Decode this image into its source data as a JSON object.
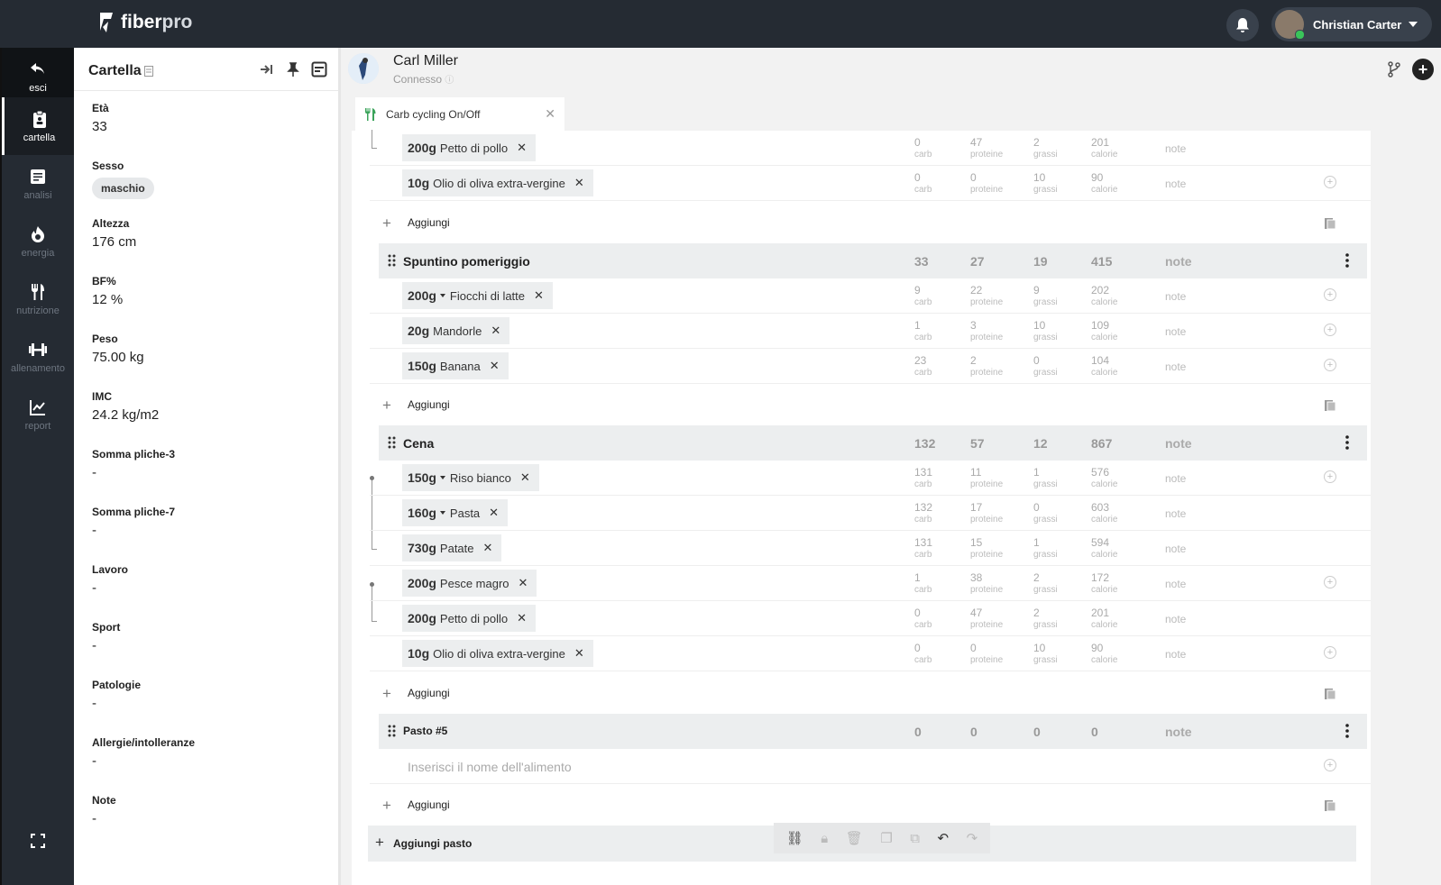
{
  "brand": {
    "name_a": "fiber",
    "name_b": "pro"
  },
  "header": {
    "user_name": "Christian Carter"
  },
  "nav": [
    {
      "label": "esci",
      "icon": "back-arrow-icon"
    },
    {
      "label": "cartella",
      "icon": "clipboard-icon"
    },
    {
      "label": "analisi",
      "icon": "document-icon"
    },
    {
      "label": "energia",
      "icon": "flame-icon"
    },
    {
      "label": "nutrizione",
      "icon": "cutlery-icon"
    },
    {
      "label": "allenamento",
      "icon": "dumbbell-icon"
    },
    {
      "label": "report",
      "icon": "chart-icon"
    }
  ],
  "panel": {
    "title": "Cartella",
    "fields": [
      {
        "label": "Età",
        "value": "33"
      },
      {
        "label": "Sesso",
        "value": "maschio"
      },
      {
        "label": "Altezza",
        "value": "176 cm"
      },
      {
        "label": "BF%",
        "value": "12 %"
      },
      {
        "label": "Peso",
        "value": "75.00 kg"
      },
      {
        "label": "IMC",
        "value": "24.2 kg/m2"
      },
      {
        "label": "Somma pliche-3",
        "value": "-"
      },
      {
        "label": "Somma pliche-7",
        "value": "-"
      },
      {
        "label": "Lavoro",
        "value": "-"
      },
      {
        "label": "Sport",
        "value": "-"
      },
      {
        "label": "Patologie",
        "value": "-"
      },
      {
        "label": "Allergie/intolleranze",
        "value": "-"
      },
      {
        "label": "Note",
        "value": "-"
      }
    ]
  },
  "patient": {
    "name": "Carl Miller",
    "status": "Connesso"
  },
  "tab": {
    "label": "Carb cycling On/Off"
  },
  "units": {
    "carb": "carb",
    "prot": "proteine",
    "fat": "grassi",
    "kcal": "calorie"
  },
  "note_label": "note",
  "add_label": "Aggiungi",
  "add_meal_label": "Aggiungi pasto",
  "food_placeholder": "Inserisci il nome dell'alimento",
  "rows_top": [
    {
      "qty": "200g",
      "food": "Petto di pollo",
      "carb": "0",
      "prot": "47",
      "fat": "2",
      "kcal": "201"
    },
    {
      "qty": "10g",
      "food": "Olio di oliva extra-vergine",
      "carb": "0",
      "prot": "0",
      "fat": "10",
      "kcal": "90"
    }
  ],
  "meals": [
    {
      "name": "Spuntino pomeriggio",
      "carb": "33",
      "prot": "27",
      "fat": "19",
      "kcal": "415",
      "items": [
        {
          "qty": "200g",
          "food": "Fiocchi di latte",
          "dd": true,
          "carb": "9",
          "prot": "22",
          "fat": "9",
          "kcal": "202"
        },
        {
          "qty": "20g",
          "food": "Mandorle",
          "dd": false,
          "carb": "1",
          "prot": "3",
          "fat": "10",
          "kcal": "109"
        },
        {
          "qty": "150g",
          "food": "Banana",
          "dd": false,
          "carb": "23",
          "prot": "2",
          "fat": "0",
          "kcal": "104"
        }
      ]
    },
    {
      "name": "Cena",
      "carb": "132",
      "prot": "57",
      "fat": "12",
      "kcal": "867",
      "items": [
        {
          "qty": "150g",
          "food": "Riso bianco",
          "dd": true,
          "carb": "131",
          "prot": "11",
          "fat": "1",
          "kcal": "576"
        },
        {
          "qty": "160g",
          "food": "Pasta",
          "dd": true,
          "carb": "132",
          "prot": "17",
          "fat": "0",
          "kcal": "603"
        },
        {
          "qty": "730g",
          "food": "Patate",
          "dd": false,
          "carb": "131",
          "prot": "15",
          "fat": "1",
          "kcal": "594"
        },
        {
          "qty": "200g",
          "food": "Pesce magro",
          "dd": false,
          "carb": "1",
          "prot": "38",
          "fat": "2",
          "kcal": "172"
        },
        {
          "qty": "200g",
          "food": "Petto di pollo",
          "dd": false,
          "carb": "0",
          "prot": "47",
          "fat": "2",
          "kcal": "201"
        },
        {
          "qty": "10g",
          "food": "Olio di oliva extra-vergine",
          "dd": false,
          "carb": "0",
          "prot": "0",
          "fat": "10",
          "kcal": "90"
        }
      ]
    },
    {
      "name": "Pasto #5",
      "carb": "0",
      "prot": "0",
      "fat": "0",
      "kcal": "0",
      "items": []
    }
  ]
}
